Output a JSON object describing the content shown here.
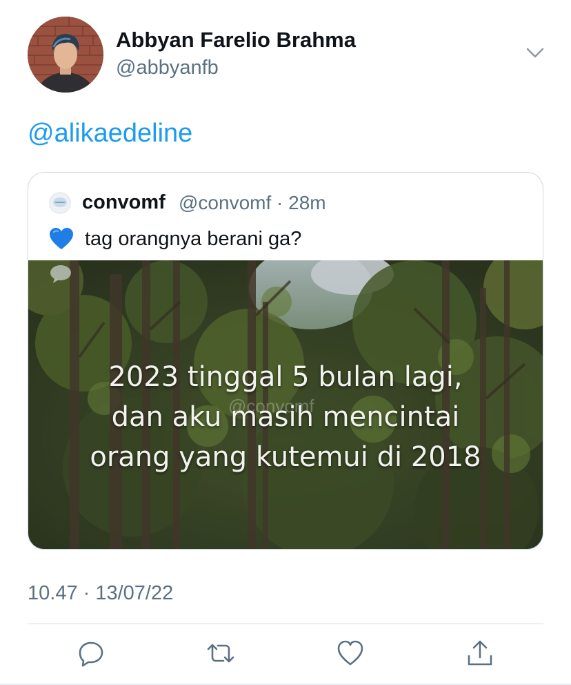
{
  "tweet": {
    "author": {
      "display_name": "Abbyan Farelio Brahma",
      "handle": "@abbyanfb"
    },
    "text_mention": "@alikaedeline",
    "timestamp": "10.47 · 13/07/22"
  },
  "quoted_tweet": {
    "name": "convomf",
    "meta": "@convomf · 28m",
    "emoji": "💙",
    "text": "tag orangnya berani ga?",
    "media": {
      "caption_lines": [
        "2023 tinggal 5 bulan lagi,",
        "dan aku masih mencintai",
        "orang yang kutemui di 2018"
      ],
      "watermark": "@convomf"
    }
  },
  "icons": {
    "more": "chevron-down-icon",
    "reply": "reply-icon",
    "retweet": "retweet-icon",
    "like": "heart-icon",
    "share": "share-icon"
  },
  "colors": {
    "link": "#1d9bf0",
    "secondary_text": "#5b7083",
    "border": "#cfd9de"
  }
}
